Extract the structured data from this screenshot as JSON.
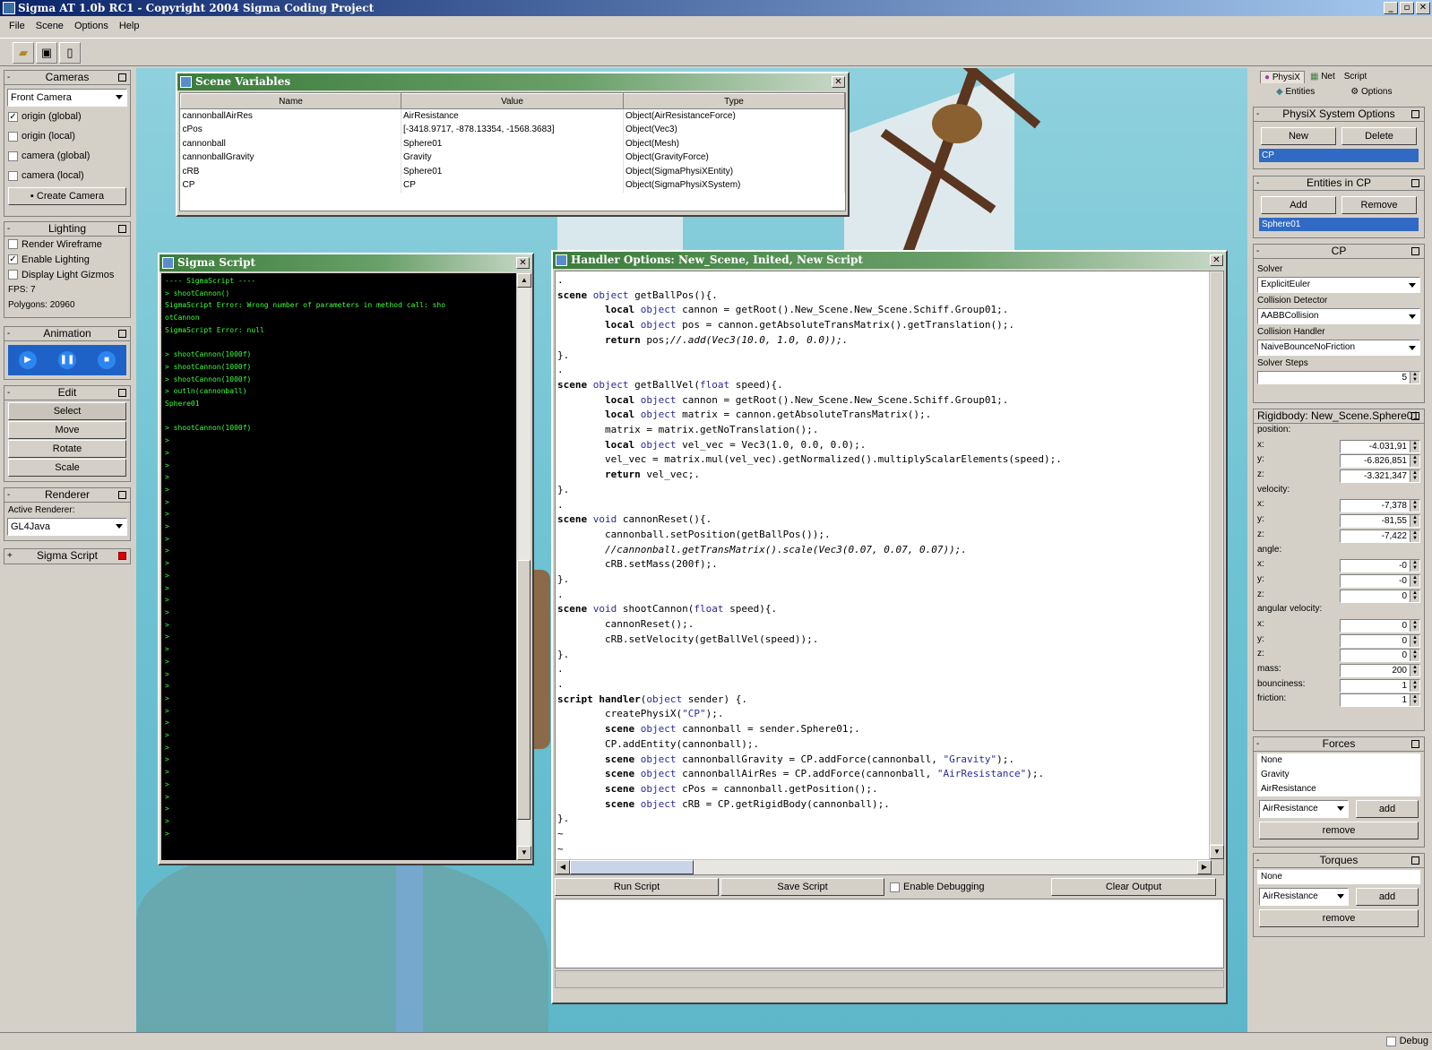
{
  "window": {
    "title": "Sigma AT 1.0b RC1 - Copyright 2004 Sigma Coding Project",
    "min": "_",
    "max": "▫",
    "close": "✕"
  },
  "menu": [
    "File",
    "Scene",
    "Options",
    "Help"
  ],
  "left": {
    "cameras": {
      "title": "Cameras",
      "selected": "Front Camera",
      "options": [
        {
          "label": "origin (global)",
          "checked": "✓"
        },
        {
          "label": "origin (local)",
          "checked": ""
        },
        {
          "label": "camera (global)",
          "checked": ""
        },
        {
          "label": "camera (local)",
          "checked": ""
        }
      ],
      "create_button": "Create Camera"
    },
    "lighting": {
      "title": "Lighting",
      "options": [
        {
          "label": "Render Wireframe",
          "checked": ""
        },
        {
          "label": "Enable Lighting",
          "checked": "✓"
        },
        {
          "label": "Display Light Gizmos",
          "checked": ""
        }
      ],
      "fps": "FPS: 7",
      "polygons": "Polygons: 20960"
    },
    "animation": {
      "title": "Animation"
    },
    "edit": {
      "title": "Edit",
      "buttons": [
        "Select",
        "Move",
        "Rotate",
        "Scale"
      ]
    },
    "renderer": {
      "title": "Renderer",
      "label": "Active Renderer:",
      "selected": "GL4Java"
    },
    "sigma_script": {
      "title": "Sigma Script",
      "toggle": "+"
    }
  },
  "scene_vars": {
    "title": "Scene Variables",
    "columns": [
      "Name",
      "Value",
      "Type"
    ],
    "rows": [
      [
        "cannonballAirRes",
        "AirResistance",
        "Object(AirResistanceForce)"
      ],
      [
        "cPos",
        "[-3418.9717, -878.13354, -1568.3683]",
        "Object(Vec3)"
      ],
      [
        "cannonball",
        "Sphere01",
        "Object(Mesh)"
      ],
      [
        "cannonballGravity",
        "Gravity",
        "Object(GravityForce)"
      ],
      [
        "cRB",
        "Sphere01",
        "Object(SigmaPhysiXEntity)"
      ],
      [
        "CP",
        "CP",
        "Object(SigmaPhysiXSystem)"
      ]
    ]
  },
  "sigma_script": {
    "title": "Sigma Script",
    "output": "---- SigmaScript ----\n> shootCannon()\nSigmaScript Error: Wrong number of parameters in method call: sho\notCannon\nSigmaScript Error: null\n\n> shootCannon(1000f)\n> shootCannon(1000f)\n> shootCannon(1000f)\n> outln(cannonball)\nSphere01\n\n> shootCannon(1000f)\n>\n>\n>\n>\n>\n>\n>\n>\n>\n>\n>\n>\n>\n>\n>\n>\n>\n>\n>\n>\n>\n>\n>\n>\n>\n>\n>\n>\n>\n>\n>\n>\n>"
  },
  "handler": {
    "title": "Handler Options: New_Scene, Inited, New Script",
    "code_lines": [
      [
        [
          "p",
          "."
        ]
      ],
      [
        [
          "kw",
          "scene"
        ],
        [
          "p",
          " "
        ],
        [
          "ty",
          "object"
        ],
        [
          "p",
          " getBallPos(){."
        ]
      ],
      [
        [
          "p",
          "        "
        ],
        [
          "kw",
          "local"
        ],
        [
          "p",
          " "
        ],
        [
          "ty",
          "object"
        ],
        [
          "p",
          " cannon = getRoot().New_Scene.New_Scene.Schiff.Group01;."
        ]
      ],
      [
        [
          "p",
          "        "
        ],
        [
          "kw",
          "local"
        ],
        [
          "p",
          " "
        ],
        [
          "ty",
          "object"
        ],
        [
          "p",
          " pos = cannon.getAbsoluteTransMatrix().getTranslation();."
        ]
      ],
      [
        [
          "p",
          "        "
        ],
        [
          "kw",
          "return"
        ],
        [
          "p",
          " pos;"
        ],
        [
          "cm",
          "//.add(Vec3(10.0, 1.0, 0.0));."
        ]
      ],
      [
        [
          "p",
          "}."
        ]
      ],
      [
        [
          "p",
          "."
        ]
      ],
      [
        [
          "kw",
          "scene"
        ],
        [
          "p",
          " "
        ],
        [
          "ty",
          "object"
        ],
        [
          "p",
          " getBallVel("
        ],
        [
          "ty",
          "float"
        ],
        [
          "p",
          " speed){."
        ]
      ],
      [
        [
          "p",
          "        "
        ],
        [
          "kw",
          "local"
        ],
        [
          "p",
          " "
        ],
        [
          "ty",
          "object"
        ],
        [
          "p",
          " cannon = getRoot().New_Scene.New_Scene.Schiff.Group01;."
        ]
      ],
      [
        [
          "p",
          "        "
        ],
        [
          "kw",
          "local"
        ],
        [
          "p",
          " "
        ],
        [
          "ty",
          "object"
        ],
        [
          "p",
          " matrix = cannon.getAbsoluteTransMatrix();."
        ]
      ],
      [
        [
          "p",
          "        matrix = matrix.getNoTranslation();."
        ]
      ],
      [
        [
          "p",
          "        "
        ],
        [
          "kw",
          "local"
        ],
        [
          "p",
          " "
        ],
        [
          "ty",
          "object"
        ],
        [
          "p",
          " vel_vec = Vec3(1.0, 0.0, 0.0);."
        ]
      ],
      [
        [
          "p",
          "        vel_vec = matrix.mul(vel_vec).getNormalized().multiplyScalarElements(speed);."
        ]
      ],
      [
        [
          "p",
          "        "
        ],
        [
          "kw",
          "return"
        ],
        [
          "p",
          " vel_vec;."
        ]
      ],
      [
        [
          "p",
          "}."
        ]
      ],
      [
        [
          "p",
          "."
        ]
      ],
      [
        [
          "kw",
          "scene"
        ],
        [
          "p",
          " "
        ],
        [
          "ty",
          "void"
        ],
        [
          "p",
          " cannonReset(){."
        ]
      ],
      [
        [
          "p",
          "        cannonball.setPosition(getBallPos());."
        ]
      ],
      [
        [
          "p",
          "        "
        ],
        [
          "cm",
          "//cannonball.getTransMatrix().scale(Vec3(0.07, 0.07, 0.07));."
        ]
      ],
      [
        [
          "p",
          "        cRB.setMass(200f);."
        ]
      ],
      [
        [
          "p",
          "}."
        ]
      ],
      [
        [
          "p",
          "."
        ]
      ],
      [
        [
          "kw",
          "scene"
        ],
        [
          "p",
          " "
        ],
        [
          "ty",
          "void"
        ],
        [
          "p",
          " shootCannon("
        ],
        [
          "ty",
          "float"
        ],
        [
          "p",
          " speed){."
        ]
      ],
      [
        [
          "p",
          "        cannonReset();."
        ]
      ],
      [
        [
          "p",
          "        cRB.setVelocity(getBallVel(speed));."
        ]
      ],
      [
        [
          "p",
          "}."
        ]
      ],
      [
        [
          "p",
          "."
        ]
      ],
      [
        [
          "p",
          "."
        ]
      ],
      [
        [
          "kw",
          "script"
        ],
        [
          "p",
          " "
        ],
        [
          "kw",
          "handler"
        ],
        [
          "p",
          "("
        ],
        [
          "ty",
          "object"
        ],
        [
          "p",
          " sender) {."
        ]
      ],
      [
        [
          "p",
          "        createPhysiX("
        ],
        [
          "st",
          "\"CP\""
        ],
        [
          "p",
          ");."
        ]
      ],
      [
        [
          "p",
          "        "
        ],
        [
          "kw",
          "scene"
        ],
        [
          "p",
          " "
        ],
        [
          "ty",
          "object"
        ],
        [
          "p",
          " cannonball = sender.Sphere01;."
        ]
      ],
      [
        [
          "p",
          "        CP.addEntity(cannonball);."
        ]
      ],
      [
        [
          "p",
          "        "
        ],
        [
          "kw",
          "scene"
        ],
        [
          "p",
          " "
        ],
        [
          "ty",
          "object"
        ],
        [
          "p",
          " cannonballGravity = CP.addForce(cannonball, "
        ],
        [
          "st",
          "\"Gravity\""
        ],
        [
          "p",
          ");."
        ]
      ],
      [
        [
          "p",
          "        "
        ],
        [
          "kw",
          "scene"
        ],
        [
          "p",
          " "
        ],
        [
          "ty",
          "object"
        ],
        [
          "p",
          " cannonballAirRes = CP.addForce(cannonball, "
        ],
        [
          "st",
          "\"AirResistance\""
        ],
        [
          "p",
          ");."
        ]
      ],
      [
        [
          "p",
          "        "
        ],
        [
          "kw",
          "scene"
        ],
        [
          "p",
          " "
        ],
        [
          "ty",
          "object"
        ],
        [
          "p",
          " cPos = cannonball.getPosition();."
        ]
      ],
      [
        [
          "p",
          "        "
        ],
        [
          "kw",
          "scene"
        ],
        [
          "p",
          " "
        ],
        [
          "ty",
          "object"
        ],
        [
          "p",
          " cRB = CP.getRigidBody(cannonball);."
        ]
      ],
      [
        [
          "p",
          "}."
        ]
      ],
      [
        [
          "p",
          "~"
        ]
      ],
      [
        [
          "p",
          "~"
        ]
      ]
    ],
    "run_button": "Run Script",
    "save_button": "Save Script",
    "debug_label": "Enable Debugging",
    "clear_button": "Clear Output"
  },
  "right": {
    "tabs_row1": [
      "PhysiX",
      "Net",
      "Script"
    ],
    "tabs_row2": [
      "Entities",
      "Options"
    ],
    "system_options": {
      "title": "PhysiX System Options",
      "new_button": "New",
      "delete_button": "Delete",
      "selected": "CP"
    },
    "entities": {
      "title": "Entities in CP",
      "add_button": "Add",
      "remove_button": "Remove",
      "selected": "Sphere01"
    },
    "cp": {
      "title": "CP",
      "solver_label": "Solver",
      "solver": "ExplicitEuler",
      "collision_label": "Collision Detector",
      "collision": "AABBCollision",
      "handler_label": "Collision Handler",
      "handler": "NaiveBounceNoFriction",
      "steps_label": "Solver Steps",
      "steps": "5"
    },
    "rigidbody": {
      "title": "Rigidbody: New_Scene.Sphere01",
      "rows": [
        {
          "label": "position:",
          "value": ""
        },
        {
          "label": "x:",
          "value": "-4.031,91"
        },
        {
          "label": "y:",
          "value": "-6.826,851"
        },
        {
          "label": "z:",
          "value": "-3.321,347"
        },
        {
          "label": "velocity:",
          "value": ""
        },
        {
          "label": "x:",
          "value": "-7,378"
        },
        {
          "label": "y:",
          "value": "-81,55"
        },
        {
          "label": "z:",
          "value": "-7,422"
        },
        {
          "label": "angle:",
          "value": ""
        },
        {
          "label": "x:",
          "value": "-0"
        },
        {
          "label": "y:",
          "value": "-0"
        },
        {
          "label": "z:",
          "value": "0"
        },
        {
          "label": "angular velocity:",
          "value": ""
        },
        {
          "label": "x:",
          "value": "0"
        },
        {
          "label": "y:",
          "value": "0"
        },
        {
          "label": "z:",
          "value": "0"
        },
        {
          "label": "mass:",
          "value": "200"
        },
        {
          "label": "bounciness:",
          "value": "1"
        },
        {
          "label": "friction:",
          "value": "1"
        }
      ]
    },
    "forces": {
      "title": "Forces",
      "items": [
        "None",
        "Gravity",
        "AirResistance"
      ],
      "selected": "AirResistance",
      "add_button": "add",
      "remove_button": "remove"
    },
    "torques": {
      "title": "Torques",
      "items": [
        "None"
      ],
      "selected": "AirResistance",
      "add_button": "add",
      "remove_button": "remove"
    }
  },
  "status": {
    "debug_label": "Debug"
  }
}
